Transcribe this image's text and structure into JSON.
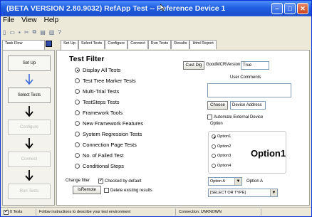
{
  "window": {
    "title": "(BETA VERSION 2.80.9032) RefApp Test -- Reference Device 1",
    "buttons": {
      "minimize": "–",
      "maximize": "□",
      "close": "✕"
    }
  },
  "menu": [
    "File",
    "View",
    "Help"
  ],
  "toolbar_icons": [
    "new-icon",
    "open-icon",
    "save-icon",
    "cut-icon",
    "copy-icon",
    "paste-icon",
    "print-icon",
    "help-icon"
  ],
  "outer_tabs": [
    "Task Flow"
  ],
  "inner_tabs": [
    "Set Up",
    "Select Tests",
    "Configure",
    "Connect",
    "Run Tests",
    "Results",
    "Html Report"
  ],
  "taskflow": {
    "steps": [
      {
        "label": "Set Up",
        "enabled": true
      },
      {
        "label": "Select Tests",
        "enabled": true
      },
      {
        "label": "Configure",
        "enabled": false
      },
      {
        "label": "Connect",
        "enabled": false
      },
      {
        "label": "Run Tests",
        "enabled": false
      }
    ]
  },
  "test_filter": {
    "title": "Test Filter",
    "options": [
      {
        "label": "Display All Tests",
        "checked": true
      },
      {
        "label": "Test Tree Marker Tests",
        "checked": false
      },
      {
        "label": "Multi-Trial Tests",
        "checked": false
      },
      {
        "label": "TestSteps Tests",
        "checked": false
      },
      {
        "label": "Framework Tools",
        "checked": false
      },
      {
        "label": "New Framework Features",
        "checked": false
      },
      {
        "label": "System Regression Tests",
        "checked": false
      },
      {
        "label": "Connection Page Tests",
        "checked": false
      },
      {
        "label": "No. of Failed Test",
        "checked": false
      },
      {
        "label": "Conditional Steps",
        "checked": false
      }
    ],
    "change_filter_label": "Change filter",
    "checked_default_label": "Checked by default",
    "is_remote_button": "IsRemote",
    "delete_existing_label": "Delete existing results"
  },
  "right": {
    "cust_dlg_button": "Cust Dlg",
    "good_mcr_label": "GoodMCRVersion",
    "good_mcr_value": "True",
    "user_comments_label": "User Comments",
    "user_comments_value": "",
    "choose_button": "Choose",
    "device_address_value": "Device Address",
    "automate_label": "Automate External Device",
    "option_group_title": "Option",
    "option_items": [
      "Option1",
      "Option2",
      "Option3",
      "Option4"
    ],
    "option_selected": "Option1",
    "option_big_label": "Option1",
    "option_select_value": "Option A",
    "option_select_label": "Option A",
    "type_select_value": "[SELECT OR TYPE]"
  },
  "status": {
    "tests": "0 Tests",
    "message": "Follow instructions to describe your test environment",
    "connection": "Connection: UNKNOWN"
  }
}
